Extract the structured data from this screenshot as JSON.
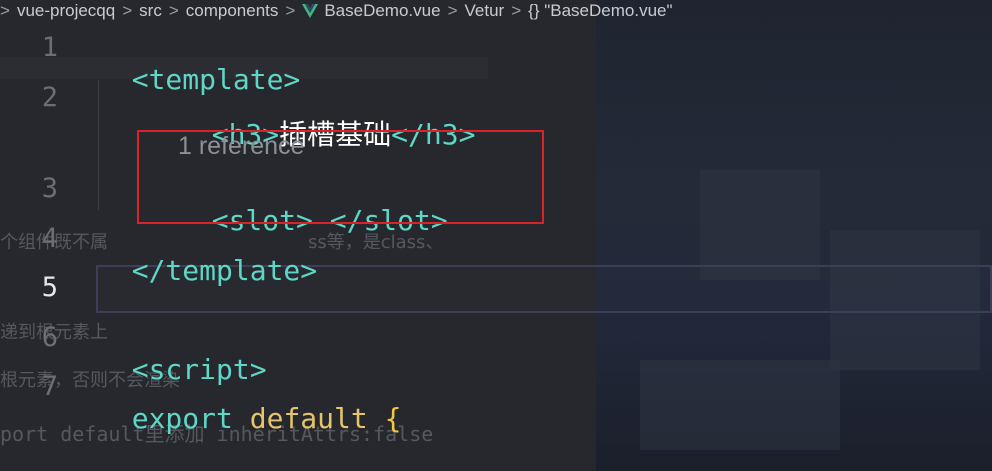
{
  "breadcrumb": {
    "items": [
      ">",
      "vue-projecqq",
      "src",
      "components",
      "BaseDemo.vue",
      "Vetur",
      "{} \"BaseDemo.vue\""
    ],
    "vue_icon_color": "#41b883"
  },
  "editor": {
    "line_numbers": [
      "1",
      "2",
      "3",
      "4",
      "5",
      "6",
      "7"
    ],
    "active_line": "5",
    "codelens": "1 reference",
    "lines": {
      "l1_tag": "<template>",
      "l2_open": "<h3>",
      "l2_text": "插槽基础",
      "l2_close": "</h3>",
      "l3_open": "<slot>",
      "l3_close": "</slot>",
      "l4_tag": "</template>",
      "l6_tag": "<script>",
      "l7_export": "export",
      "l7_default": "default",
      "l7_brace": "{"
    }
  },
  "background_text": {
    "a": "个组件既不属",
    "b": "ss等，是class、",
    "c": "递到根元素上",
    "d": "根元素，否则不会渲染",
    "e": "port default里添加 inheritAttrs:false"
  },
  "colors": {
    "tag": "#5fd7c8",
    "keyword": "#e5c46a",
    "highlight_box": "#d8232a"
  }
}
